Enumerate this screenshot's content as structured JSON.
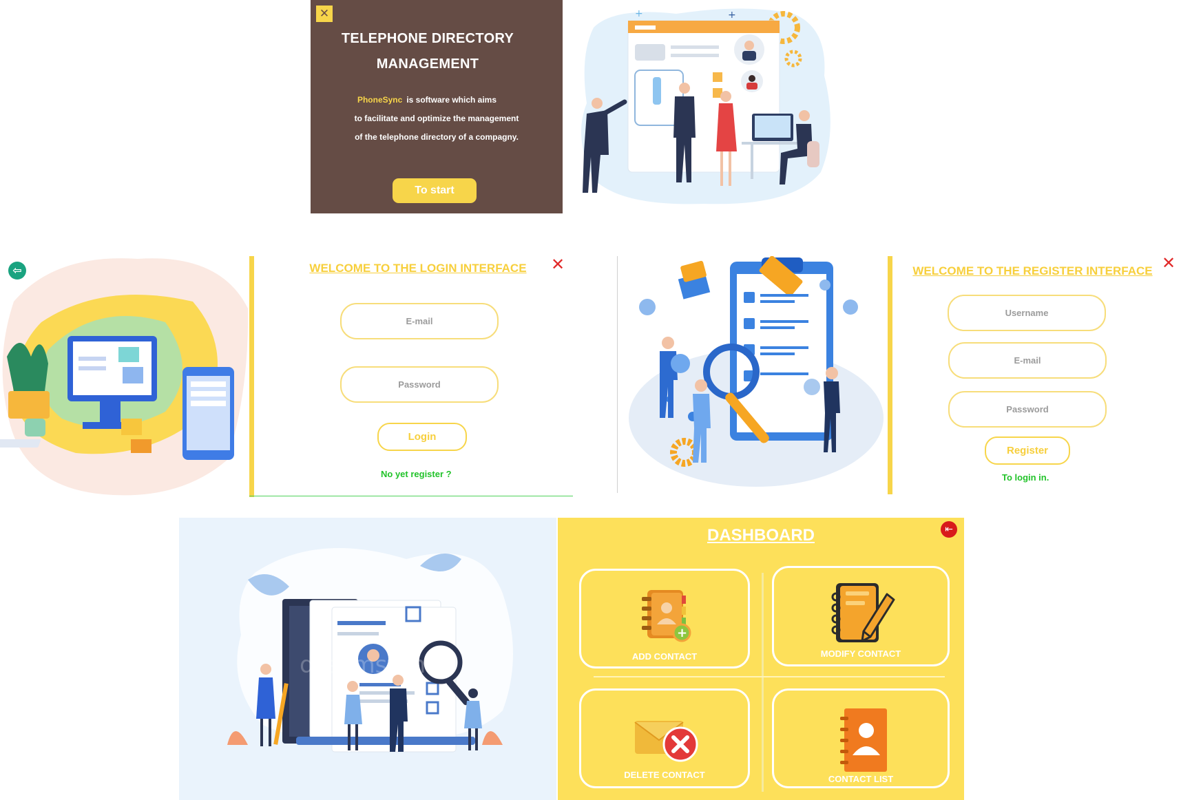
{
  "splash": {
    "title_line1": "TELEPHONE DIRECTORY",
    "title_line2": "MANAGEMENT",
    "brand": "PhoneSync",
    "desc_line1_rest": "is software which aims",
    "desc_line2": "to facilitate and optimize the management",
    "desc_line3": "of the telephone directory of a compagny.",
    "start_label": "To start",
    "close_icon": "close-icon"
  },
  "login": {
    "title": "WELCOME TO THE LOGIN INTERFACE",
    "email_placeholder": "E-mail",
    "password_placeholder": "Password",
    "login_label": "Login",
    "register_link": "No yet register  ?",
    "back_icon": "back-arrow-icon",
    "close_icon": "close-icon"
  },
  "register": {
    "title": "WELCOME TO THE REGISTER INTERFACE",
    "username_placeholder": "Username",
    "email_placeholder": "E-mail",
    "password_placeholder": "Password",
    "register_label": "Register",
    "login_link": "To login in.",
    "close_icon": "close-icon"
  },
  "dashboard": {
    "title": "DASHBOARD",
    "tiles": [
      {
        "label": "ADD CONTACT",
        "icon": "address-book-add-icon"
      },
      {
        "label": "MODIFY CONTACT",
        "icon": "notebook-pencil-icon"
      },
      {
        "label": "DELETE CONTACT",
        "icon": "envelope-delete-icon"
      },
      {
        "label": "CONTACT LIST",
        "icon": "contact-book-icon"
      }
    ],
    "logout_icon": "logout-icon"
  },
  "colors": {
    "accent_yellow": "#f7d54a",
    "splash_brown": "#654c45",
    "dashboard_yellow": "#fde05a",
    "link_green": "#22c32a",
    "close_red": "#e12a2a"
  }
}
